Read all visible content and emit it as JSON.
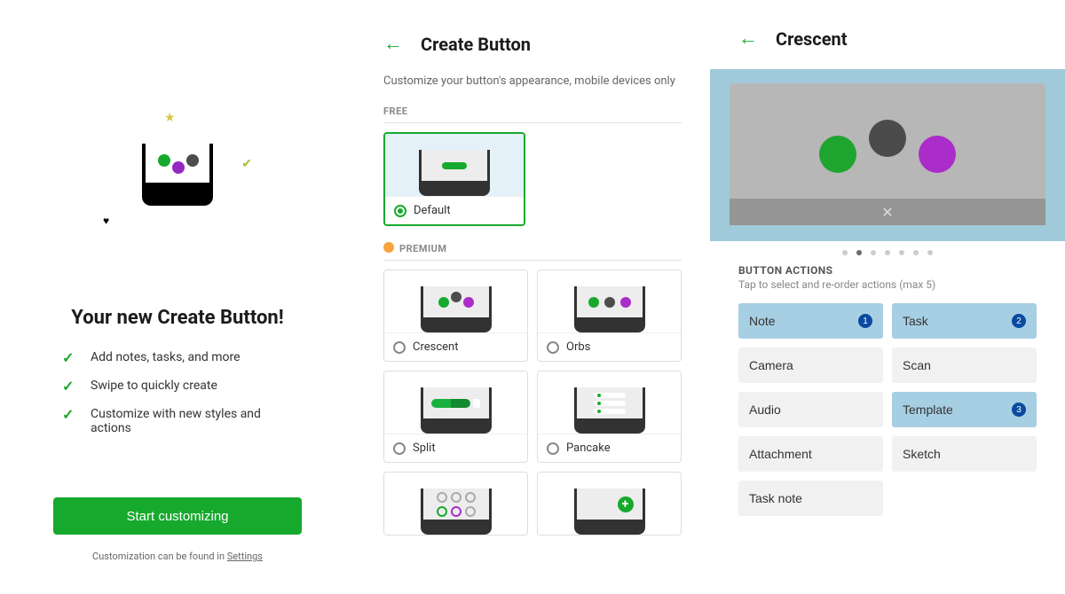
{
  "panel1": {
    "title": "Your new Create Button!",
    "features": [
      "Add notes, tasks, and more",
      "Swipe to quickly create",
      "Customize with new styles and actions"
    ],
    "cta": "Start customizing",
    "note_prefix": "Customization can be found in ",
    "note_link": "Settings"
  },
  "panel2": {
    "title": "Create Button",
    "subtitle": "Customize your button's appearance, mobile devices only",
    "free_label": "FREE",
    "premium_label": "PREMIUM",
    "free_options": [
      {
        "id": "default",
        "label": "Default",
        "selected": true
      }
    ],
    "premium_options": [
      {
        "id": "crescent",
        "label": "Crescent"
      },
      {
        "id": "orbs",
        "label": "Orbs"
      },
      {
        "id": "split",
        "label": "Split"
      },
      {
        "id": "pancake",
        "label": "Pancake"
      }
    ]
  },
  "panel3": {
    "title": "Crescent",
    "pager_count": 7,
    "pager_active": 1,
    "actions_title": "BUTTON ACTIONS",
    "actions_sub": "Tap to select and re-order actions (max 5)",
    "actions": [
      {
        "label": "Note",
        "selected": true,
        "order": 1
      },
      {
        "label": "Task",
        "selected": true,
        "order": 2
      },
      {
        "label": "Camera",
        "selected": false
      },
      {
        "label": "Scan",
        "selected": false
      },
      {
        "label": "Audio",
        "selected": false
      },
      {
        "label": "Template",
        "selected": true,
        "order": 3
      },
      {
        "label": "Attachment",
        "selected": false
      },
      {
        "label": "Sketch",
        "selected": false
      },
      {
        "label": "Task note",
        "selected": false
      }
    ]
  }
}
